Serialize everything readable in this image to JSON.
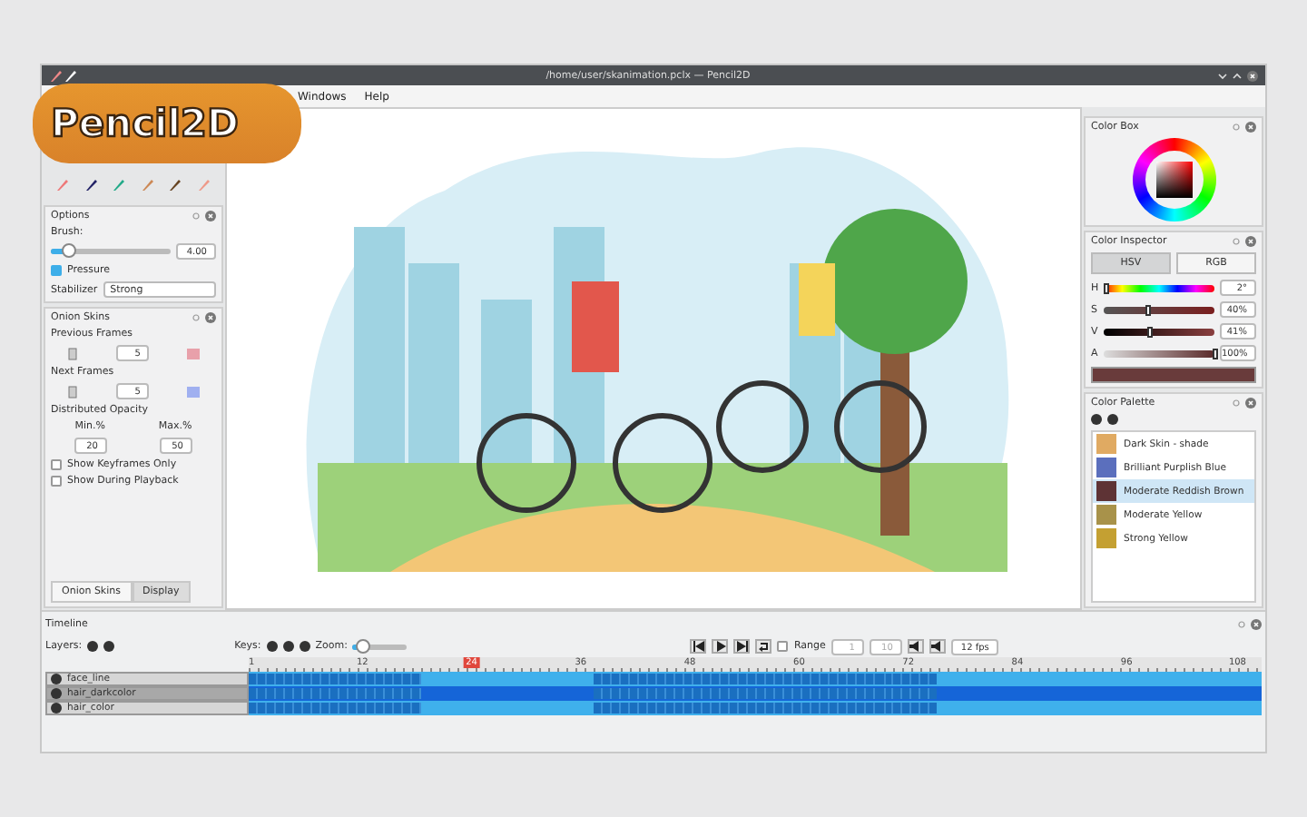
{
  "title_bar": {
    "title": "/home/user/skanimation.pclx — Pencil2D"
  },
  "menu": [
    {
      "label": "Windows"
    },
    {
      "label": "Help"
    }
  ],
  "badge": {
    "text": "Pencil2D"
  },
  "options": {
    "title": "Options",
    "brush": {
      "label": "Brush:",
      "level": 0.15,
      "value": "4.00"
    },
    "pressure": {
      "label": "Pressure",
      "checked": true
    },
    "stabilizer": {
      "label": "Stabilizer",
      "value": "Strong"
    }
  },
  "onion_skins": {
    "title": "Onion Skins",
    "previous_label": "Previous Frames",
    "previous_value": "5",
    "next_label": "Next Frames",
    "next_value": "5",
    "opacity_label": "Distributed Opacity",
    "min_label": "Min.%",
    "min_value": "20",
    "max_label": "Max.%",
    "max_value": "50",
    "options": [
      {
        "label": "Show Keyframes Only",
        "checked": false
      },
      {
        "label": "Show During Playback",
        "checked": false
      }
    ],
    "tabs": [
      {
        "label": "Onion Skins",
        "selected": true
      },
      {
        "label": "Display",
        "selected": false
      }
    ]
  },
  "color_box": {
    "title": "Color Box"
  },
  "color_inspector": {
    "title": "Color Inspector",
    "tabs": [
      {
        "label": "HSV",
        "selected": true
      },
      {
        "label": "RGB",
        "selected": false
      }
    ],
    "channels": [
      {
        "name": "H",
        "level": 0.02,
        "value": "2°"
      },
      {
        "name": "S",
        "level": 0.4,
        "value": "40%"
      },
      {
        "name": "V",
        "level": 0.41,
        "value": "41%"
      },
      {
        "name": "A",
        "level": 1,
        "value": "100%"
      }
    ],
    "color": "#693b3b"
  },
  "color_palette": {
    "title": "Color Palette",
    "swatches": [
      {
        "name": "Dark Skin - shade",
        "color": "#e0aa62",
        "selected": false
      },
      {
        "name": "Brilliant Purplish Blue",
        "color": "#5b6fbd",
        "selected": false
      },
      {
        "name": "Moderate Reddish Brown",
        "color": "#5e3335",
        "selected": true
      },
      {
        "name": "Moderate Yellow",
        "color": "#a8924a",
        "selected": false
      },
      {
        "name": "Strong Yellow",
        "color": "#c4a032",
        "selected": false
      }
    ]
  },
  "timeline": {
    "title": "Timeline",
    "layers_label": "Layers:",
    "keys_label": "Keys:",
    "zoom": {
      "label": "Zoom:",
      "level": 0.2
    },
    "range": {
      "label": "Range",
      "checked": false,
      "start": "1",
      "end": "10"
    },
    "fps": "12 fps",
    "ruler": [
      {
        "label": "1",
        "current": false
      },
      {
        "label": "12",
        "current": false
      },
      {
        "label": "24",
        "current": true
      },
      {
        "label": "36",
        "current": false
      },
      {
        "label": "48",
        "current": false
      },
      {
        "label": "60",
        "current": false
      },
      {
        "label": "72",
        "current": false
      },
      {
        "label": "84",
        "current": false
      },
      {
        "label": "96",
        "current": false
      },
      {
        "label": "108",
        "current": false
      }
    ],
    "layers": [
      {
        "name": "face_line",
        "selected": false
      },
      {
        "name": "hair_darkcolor",
        "selected": true
      },
      {
        "name": "hair_color",
        "selected": false
      }
    ]
  }
}
